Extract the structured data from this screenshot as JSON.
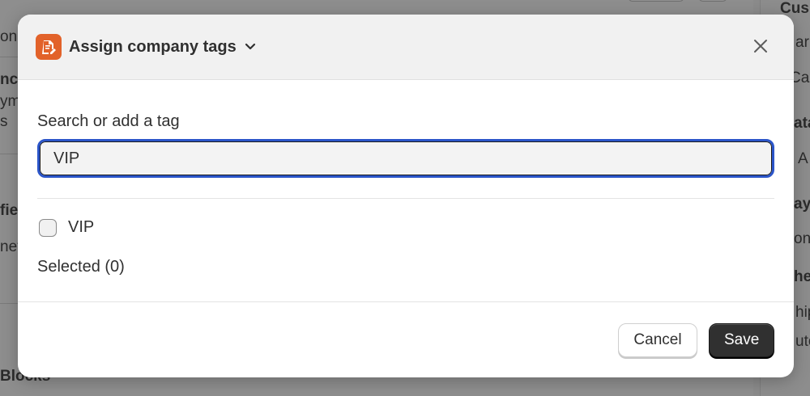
{
  "background": {
    "left_fragments": [
      "on",
      "nc",
      "ym",
      "s",
      "fie",
      "net",
      "Blocks"
    ],
    "right_fragments": [
      "Cus",
      "ar",
      "Ca",
      "ata",
      "A",
      "ay",
      "on",
      "he",
      "hip",
      "uto"
    ]
  },
  "modal": {
    "title": "Assign company tags",
    "app_icon": "document-edit-icon",
    "close_icon": "close-icon",
    "chevron_icon": "chevron-down-icon",
    "search": {
      "label": "Search or add a tag",
      "value": "VIP"
    },
    "options": [
      {
        "label": "VIP",
        "checked": false
      }
    ],
    "selected_text": "Selected (0)",
    "footer": {
      "cancel_label": "Cancel",
      "save_label": "Save"
    }
  },
  "colors": {
    "accent_focus": "#2b55c9",
    "app_icon_bg": "#e2622a",
    "primary_button": "#303030"
  }
}
